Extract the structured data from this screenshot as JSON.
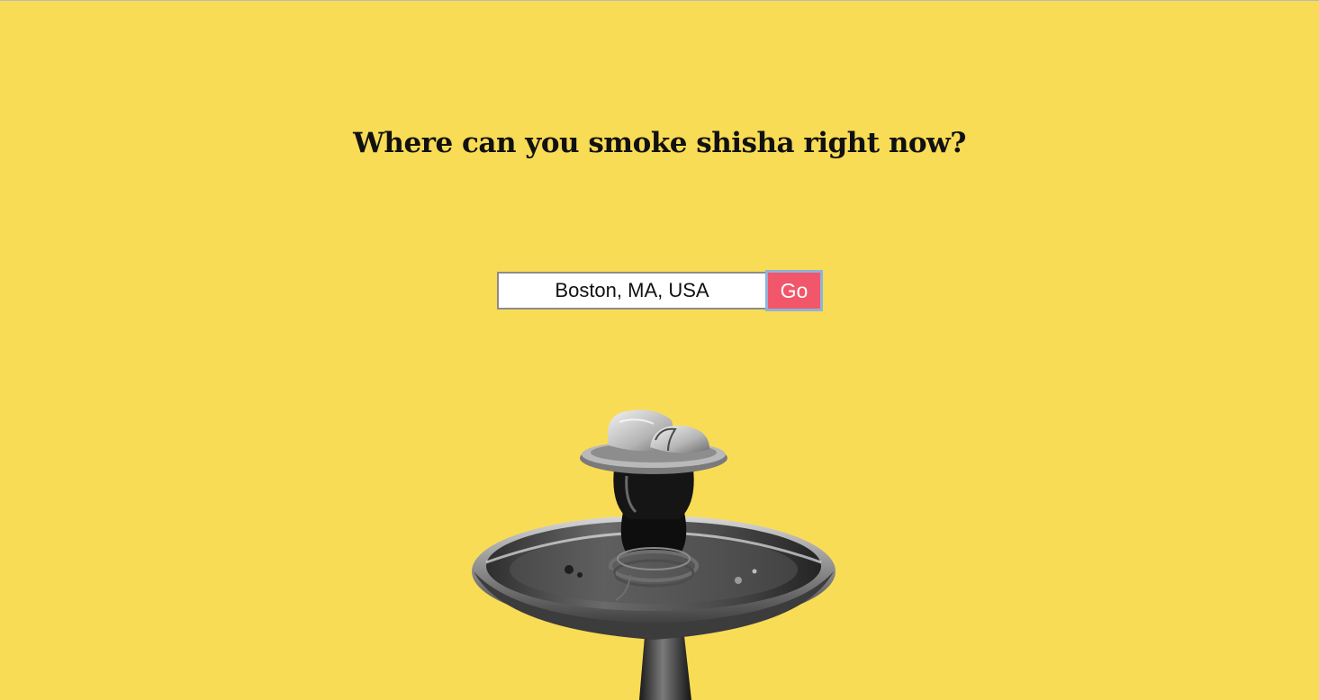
{
  "page": {
    "headline": "Where can you smoke shisha right now?"
  },
  "search": {
    "value": "Boston, MA, USA",
    "button_label": "Go"
  },
  "colors": {
    "background": "#f9dc55",
    "button": "#f1566a",
    "button_text": "#ffffff",
    "headline": "#111111"
  },
  "illustration": {
    "icon": "hookah-illustration"
  }
}
